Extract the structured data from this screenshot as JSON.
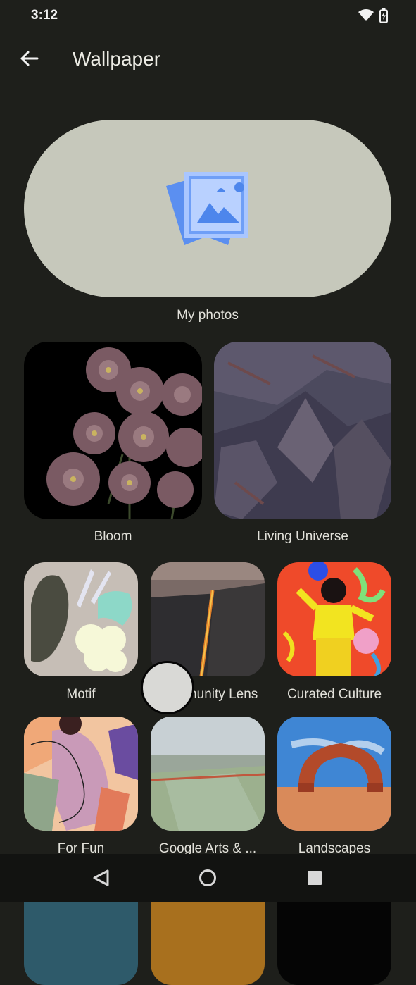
{
  "status_bar": {
    "time": "3:12",
    "icons": [
      "wifi-icon",
      "battery-charging-icon"
    ]
  },
  "app_bar": {
    "title": "Wallpaper",
    "back_icon": "arrow-back-icon"
  },
  "my_photos": {
    "label": "My photos",
    "icon": "photos-icon"
  },
  "categories": [
    {
      "label": "Bloom"
    },
    {
      "label": "Living Universe"
    },
    {
      "label": "Motif"
    },
    {
      "label": "Community Lens"
    },
    {
      "label": "Curated Culture"
    },
    {
      "label": "For Fun"
    },
    {
      "label": "Google Arts & ..."
    },
    {
      "label": "Landscapes"
    }
  ],
  "nav_bar": {
    "icons": [
      "back-triangle-icon",
      "home-circle-icon",
      "recents-square-icon"
    ]
  }
}
